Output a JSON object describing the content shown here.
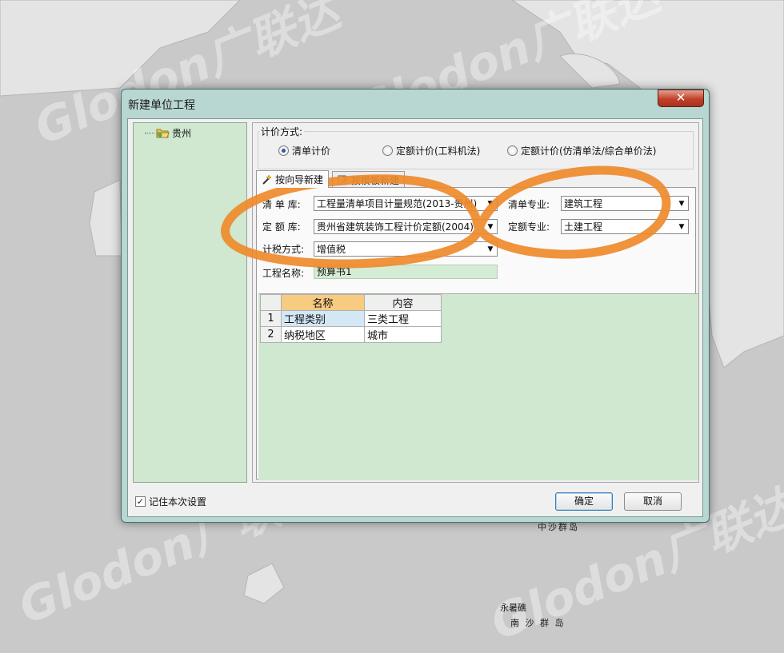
{
  "background": {
    "watermark_text": "Glodon广联达",
    "map_labels": [
      "中沙群岛",
      "永暑礁",
      "南 沙 群 岛"
    ]
  },
  "dialog": {
    "title": "新建单位工程",
    "close_glyph": "✕",
    "tree": {
      "root_label": "贵州"
    },
    "pricing": {
      "group_label": "计价方式:",
      "options": [
        "清单计价",
        "定额计价(工料机法)",
        "定额计价(仿清单法/综合单价法)"
      ],
      "selected_index": 0
    },
    "tabs": [
      {
        "label": "按向导新建",
        "active": true,
        "icon": "wand-icon"
      },
      {
        "label": "按模板新建",
        "active": false,
        "icon": "template-icon"
      }
    ],
    "form": {
      "list_library_label": "清 单 库:",
      "list_library_value": "工程量清单项目计量规范(2013-贵州)",
      "quota_library_label": "定 额 库:",
      "quota_library_value": "贵州省建筑装饰工程计价定额(2004)",
      "tax_method_label": "计税方式:",
      "tax_method_value": "增值税",
      "list_specialty_label": "清单专业:",
      "list_specialty_value": "建筑工程",
      "quota_specialty_label": "定额专业:",
      "quota_specialty_value": "土建工程",
      "project_name_label": "工程名称:",
      "project_name_value": "预算书1"
    },
    "grid": {
      "headers": [
        "名称",
        "内容"
      ],
      "rows": [
        {
          "num": "1",
          "name": "工程类别",
          "content": "三类工程"
        },
        {
          "num": "2",
          "name": "纳税地区",
          "content": "城市"
        }
      ]
    },
    "remember_label": "记住本次设置",
    "remember_checked": true,
    "ok_label": "确定",
    "cancel_label": "取消"
  },
  "colors": {
    "annotation": "#ef8a2c",
    "dialog_frame": "#b8d6d2",
    "panel_green": "#cfe8cf"
  }
}
